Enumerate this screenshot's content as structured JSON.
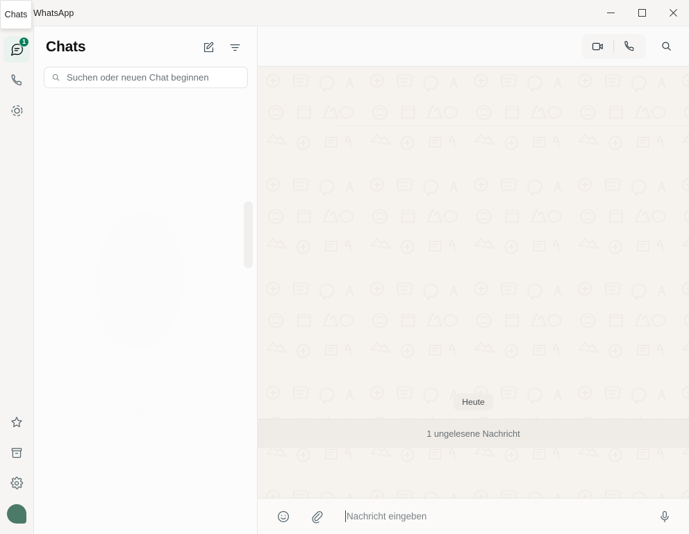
{
  "window": {
    "app_title": "WhatsApp",
    "tooltip": "Chats",
    "controls": {
      "minimize": "minimize-button",
      "maximize": "maximize-button",
      "close": "close-button"
    }
  },
  "rail": {
    "top_items": [
      {
        "name": "chats",
        "icon": "chats-icon",
        "badge": "1",
        "active": true
      },
      {
        "name": "calls",
        "icon": "phone-icon",
        "badge": "",
        "active": false
      },
      {
        "name": "status",
        "icon": "status-icon",
        "badge": "",
        "active": false
      }
    ],
    "bottom_items": [
      {
        "name": "starred",
        "icon": "star-icon"
      },
      {
        "name": "archived",
        "icon": "archive-icon"
      },
      {
        "name": "settings",
        "icon": "gear-icon"
      },
      {
        "name": "profile",
        "icon": "avatar-icon"
      }
    ]
  },
  "chat_list": {
    "title": "Chats",
    "new_chat_label": "new-chat-icon",
    "filter_label": "filter-icon",
    "search": {
      "placeholder": "Suchen oder neuen Chat beginnen",
      "value": "",
      "icon": "search-icon"
    },
    "items": [],
    "ghost_text": "···"
  },
  "conversation": {
    "contact_name": "",
    "actions": {
      "video_call": "video-call-icon",
      "voice_call": "voice-call-icon",
      "search": "search-icon"
    },
    "date_chip": "Heute",
    "unread_divider": "1 ungelesene Nachricht",
    "messages": []
  },
  "composer": {
    "emoji": "emoji-icon",
    "attach": "attach-icon",
    "placeholder": "Nachricht eingeben",
    "value": "",
    "mic": "microphone-icon"
  },
  "colors": {
    "accent_green": "#1da765",
    "badge_green": "#087f5b",
    "avatar_green": "#4b7a68",
    "titlebar_bg": "#f7f5f3",
    "chat_bg": "#f6f3ef"
  }
}
